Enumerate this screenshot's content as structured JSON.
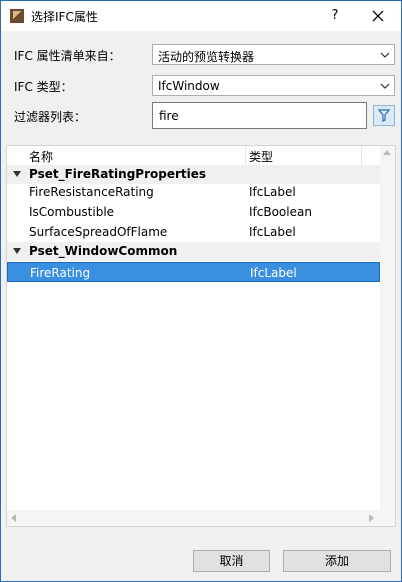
{
  "window": {
    "title": "选择IFC属性",
    "help_label": "?"
  },
  "form": {
    "source_label": "IFC 属性清单来自：",
    "source_value": "活动的预览转换器",
    "type_label": "IFC 类型：",
    "type_value": "IfcWindow",
    "filter_label": "过滤器列表：",
    "filter_value": "fire"
  },
  "list": {
    "columns": {
      "name": "名称",
      "type": "类型"
    },
    "groups": [
      {
        "name": "Pset_FireRatingProperties",
        "rows": [
          {
            "name": "FireResistanceRating",
            "type": "IfcLabel"
          },
          {
            "name": "IsCombustible",
            "type": "IfcBoolean"
          },
          {
            "name": "SurfaceSpreadOfFlame",
            "type": "IfcLabel"
          }
        ]
      },
      {
        "name": "Pset_WindowCommon",
        "rows": [
          {
            "name": "FireRating",
            "type": "IfcLabel",
            "selected": true
          }
        ]
      }
    ]
  },
  "buttons": {
    "cancel": "取消",
    "add": "添加"
  },
  "colors": {
    "selection": "#3b8fe0",
    "title_border": "#2b6cb8"
  }
}
